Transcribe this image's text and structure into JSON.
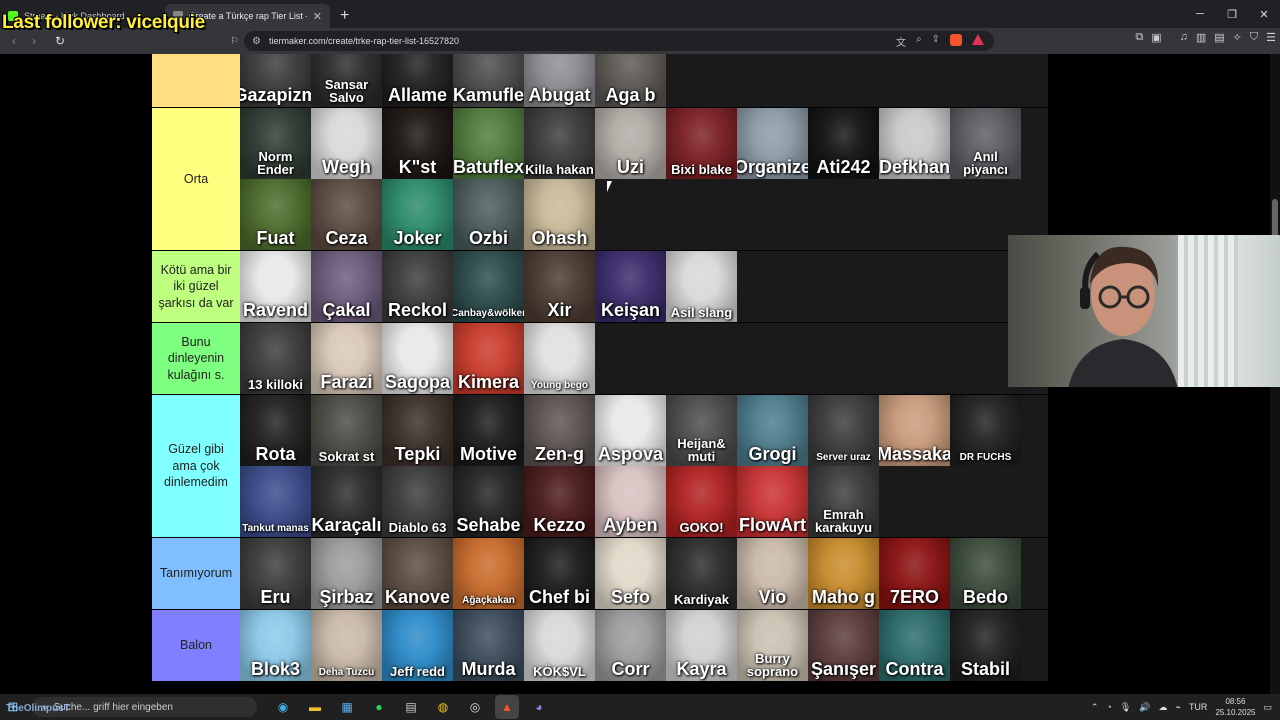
{
  "overlay": {
    "text": "Last follower: vicelquie"
  },
  "browser": {
    "tabs": [
      {
        "title": "Stream - Kick Dashboard",
        "favicon_color": "#53fc18",
        "active": false
      },
      {
        "title": "Create a Türkçe rap Tier List - Ti",
        "favicon_color": "#888888",
        "active": true
      }
    ],
    "url": "tiermaker.com/create/trke-rap-tier-list-16527820"
  },
  "tiers": [
    {
      "label": "",
      "color": "#ffdf80",
      "has_controls": false,
      "items": [
        {
          "name": "Gazapizm",
          "bg": "#3a3a3a"
        },
        {
          "name": "Sansar Salvo",
          "bg": "#2a2a2a",
          "small": true
        },
        {
          "name": "Allame",
          "bg": "#1e1e1e"
        },
        {
          "name": "Kamufle",
          "bg": "#4a4a48"
        },
        {
          "name": "Abugat",
          "bg": "#8a8c90"
        },
        {
          "name": "Aga b",
          "bg": "#5a5652"
        }
      ]
    },
    {
      "label": "Orta",
      "color": "#ffff7f",
      "has_controls": true,
      "items": [
        {
          "name": "Norm Ender",
          "bg": "#2c3a30",
          "small": true
        },
        {
          "name": "Wegh",
          "bg": "#d8d8d8"
        },
        {
          "name": "K\"st",
          "bg": "#1a1410"
        },
        {
          "name": "Batuflex",
          "bg": "#4f7a3a"
        },
        {
          "name": "Killa hakan",
          "bg": "#3a3a3a",
          "small": true
        },
        {
          "name": "Uzi",
          "bg": "#b0aaa4"
        },
        {
          "name": "Bixi blake",
          "bg": "#7a1e22",
          "small": true
        },
        {
          "name": "Organize",
          "bg": "#8a9aa6"
        },
        {
          "name": "Ati242",
          "bg": "#111111"
        },
        {
          "name": "Defkhan",
          "bg": "#c8c8c8"
        },
        {
          "name": "Anıl piyancı",
          "bg": "#5a5a60",
          "small": true
        },
        {
          "name": "Fuat",
          "bg": "#4a6a2a"
        },
        {
          "name": "Ceza",
          "bg": "#5a4a40"
        },
        {
          "name": "Joker",
          "bg": "#2a8a6a"
        },
        {
          "name": "Ozbi",
          "bg": "#4a5a5a"
        },
        {
          "name": "Ohash",
          "bg": "#c8b898"
        }
      ]
    },
    {
      "label": "Kötü ama bir iki güzel şarkısı da var",
      "color": "#bfff7f",
      "has_controls": false,
      "items": [
        {
          "name": "Ravend",
          "bg": "#e8e8e8"
        },
        {
          "name": "Çakal",
          "bg": "#6a5a7a"
        },
        {
          "name": "Reckol",
          "bg": "#3a3a3a"
        },
        {
          "name": "Canbay&wölker",
          "bg": "#2a4a4a",
          "tiny": true
        },
        {
          "name": "Xir",
          "bg": "#4a3a30"
        },
        {
          "name": "Keişan",
          "bg": "#3a2a6a"
        },
        {
          "name": "Asil slang",
          "bg": "#d8d8d8",
          "small": true
        }
      ]
    },
    {
      "label": "Bunu dinleyenin kulağını s.",
      "color": "#7fff7f",
      "has_controls": false,
      "items": [
        {
          "name": "13 killoki",
          "bg": "#3a3a3a",
          "small": true
        },
        {
          "name": "Farazi",
          "bg": "#d8c8b8"
        },
        {
          "name": "Sagopa",
          "bg": "#e8e8e8"
        },
        {
          "name": "Kimera",
          "bg": "#c83a2a"
        },
        {
          "name": "Young bego",
          "bg": "#e0e0e0",
          "tiny": true
        }
      ]
    },
    {
      "label": "Güzel gibi ama çok dinlemedim",
      "color": "#7fffff",
      "has_controls": true,
      "items": [
        {
          "name": "Rota",
          "bg": "#1e1e1e"
        },
        {
          "name": "Sokrat st",
          "bg": "#4a4a44",
          "small": true
        },
        {
          "name": "Tepki",
          "bg": "#3a2e28"
        },
        {
          "name": "Motive",
          "bg": "#1a1a1a"
        },
        {
          "name": "Zen-g",
          "bg": "#5a5250"
        },
        {
          "name": "Aspova",
          "bg": "#e8e8e8"
        },
        {
          "name": "Heijan& muti",
          "bg": "#4a4a4a",
          "small": true
        },
        {
          "name": "Grogi",
          "bg": "#4a7a8a"
        },
        {
          "name": "Server uraz",
          "bg": "#3a3a3a",
          "tiny": true
        },
        {
          "name": "Massaka",
          "bg": "#c89a7a"
        },
        {
          "name": "DR FUCHS",
          "bg": "#1e1e1e",
          "tiny": true
        },
        {
          "name": "Tankut manas",
          "bg": "#3a4a8a",
          "tiny": true
        },
        {
          "name": "Karaçalı",
          "bg": "#2a2a2a"
        },
        {
          "name": "Diablo 63",
          "bg": "#3a3a3a",
          "small": true
        },
        {
          "name": "Sehabe",
          "bg": "#222222"
        },
        {
          "name": "Kezzo",
          "bg": "#4a1a1a"
        },
        {
          "name": "Ayben",
          "bg": "#d8c0c0"
        },
        {
          "name": "GOKO!",
          "bg": "#b02020",
          "small": true
        },
        {
          "name": "FlowArt",
          "bg": "#c83030"
        },
        {
          "name": "Emrah karakuyu",
          "bg": "#3a3a3a",
          "small": true
        }
      ]
    },
    {
      "label": "Tanımıyorum",
      "color": "#7fbfff",
      "has_controls": true,
      "items": [
        {
          "name": "Eru",
          "bg": "#3a3a3a"
        },
        {
          "name": "Şirbaz",
          "bg": "#9a9a9a"
        },
        {
          "name": "Kanove",
          "bg": "#5a4a40"
        },
        {
          "name": "Ağaçkakan",
          "bg": "#c86a2a",
          "tiny": true
        },
        {
          "name": "Chef bi",
          "bg": "#1a1a1a"
        },
        {
          "name": "Sefo",
          "bg": "#e0d8c8"
        },
        {
          "name": "Kardiyak",
          "bg": "#2a2a2a",
          "small": true
        },
        {
          "name": "Vio",
          "bg": "#c8b8a8"
        },
        {
          "name": "Maho g",
          "bg": "#c88a2a"
        },
        {
          "name": "7ERO",
          "bg": "#8a1010"
        },
        {
          "name": "Bedo",
          "bg": "#3a4a3a"
        }
      ]
    },
    {
      "label": "Balon",
      "color": "#7f7fff",
      "has_controls": true,
      "items": [
        {
          "name": "Blok3",
          "bg": "#8ac8e8"
        },
        {
          "name": "Deha Tuzcu",
          "bg": "#c8b8a8",
          "tiny": true
        },
        {
          "name": "Jeff redd",
          "bg": "#2a8ac8",
          "small": true
        },
        {
          "name": "Murda",
          "bg": "#3a4a5a"
        },
        {
          "name": "KÖK$VL",
          "bg": "#d8d8d8",
          "small": true
        },
        {
          "name": "Corr",
          "bg": "#9a9a9a"
        },
        {
          "name": "Kayra",
          "bg": "#d0d0d0"
        },
        {
          "name": "Burry soprano",
          "bg": "#c8c0b0",
          "small": true
        },
        {
          "name": "Şanışer",
          "bg": "#5a3a3a"
        },
        {
          "name": "Contra",
          "bg": "#2a6a6a"
        },
        {
          "name": "Stabil",
          "bg": "#1e1e1e"
        }
      ]
    }
  ],
  "taskbar": {
    "search_placeholder": "Suche... griff hier eingeben",
    "watermark": "TheOlimpusT",
    "lang": "TUR",
    "time": "08:56",
    "date": "25.10.2025"
  }
}
